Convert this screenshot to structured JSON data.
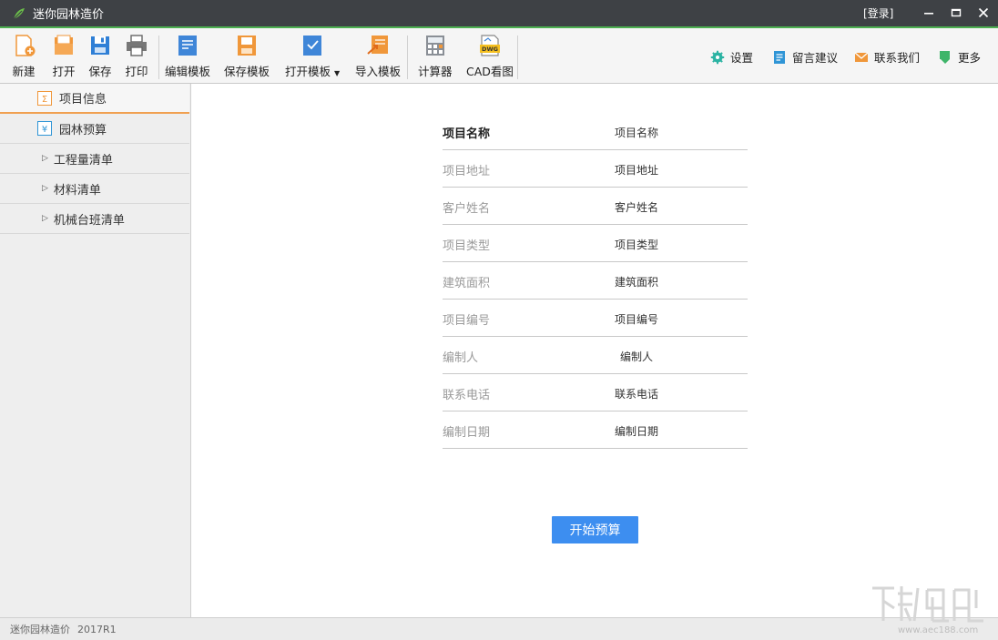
{
  "window": {
    "title": "迷你园林造价",
    "login_label": "[登录]",
    "accent_color": "#4caf50"
  },
  "toolbar": {
    "buttons": [
      {
        "label": "新建",
        "icon": "new-file-icon"
      },
      {
        "label": "打开",
        "icon": "open-folder-icon"
      },
      {
        "label": "保存",
        "icon": "save-disk-icon"
      },
      {
        "label": "打印",
        "icon": "printer-icon"
      },
      {
        "label": "编辑模板",
        "icon": "edit-template-icon"
      },
      {
        "label": "保存模板",
        "icon": "save-template-icon"
      },
      {
        "label": "打开模板",
        "icon": "open-template-icon"
      },
      {
        "label": "导入模板",
        "icon": "import-template-icon"
      },
      {
        "label": "计算器",
        "icon": "calculator-icon"
      },
      {
        "label": "CAD看图",
        "icon": "dwg-viewer-icon"
      }
    ],
    "right": [
      {
        "label": "设置",
        "icon": "gear-icon"
      },
      {
        "label": "留言建议",
        "icon": "feedback-icon"
      },
      {
        "label": "联系我们",
        "icon": "mail-icon"
      },
      {
        "label": "更多",
        "icon": "more-icon"
      }
    ]
  },
  "sidebar": {
    "items": [
      {
        "label": "项目信息",
        "icon": "sigma-icon",
        "active": true
      },
      {
        "label": "园林预算",
        "icon": "yen-icon"
      },
      {
        "label": "工程量清单",
        "icon": "expand-triangle-icon"
      },
      {
        "label": "材料清单",
        "icon": "expand-triangle-icon"
      },
      {
        "label": "机械台班清单",
        "icon": "expand-triangle-icon"
      }
    ]
  },
  "form": {
    "fields": [
      {
        "label": "项目名称",
        "value": "项目名称"
      },
      {
        "label": "项目地址",
        "value": "项目地址"
      },
      {
        "label": "客户姓名",
        "value": "客户姓名"
      },
      {
        "label": "项目类型",
        "value": "项目类型"
      },
      {
        "label": "建筑面积",
        "value": "建筑面积"
      },
      {
        "label": "项目编号",
        "value": "项目编号"
      },
      {
        "label": "编制人",
        "value": "编制人"
      },
      {
        "label": "联系电话",
        "value": "联系电话"
      },
      {
        "label": "编制日期",
        "value": "编制日期"
      }
    ],
    "start_button": "开始预算"
  },
  "status": {
    "app_name": "迷你园林造价",
    "version": "2017R1"
  },
  "watermark": {
    "text": "www.aec188.com"
  }
}
